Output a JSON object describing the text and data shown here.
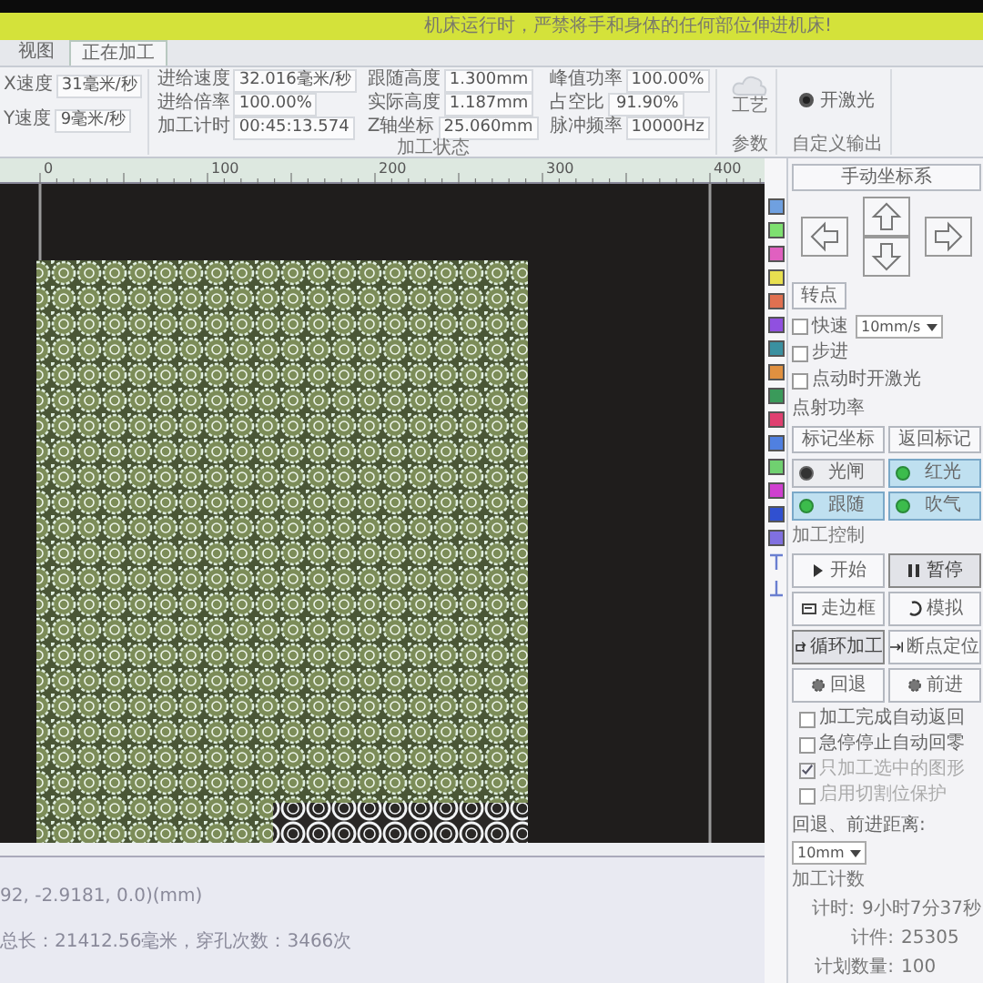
{
  "banner": "机床运行时，严禁将手和身体的任何部位伸进机床!",
  "tabs": [
    {
      "label": "视图",
      "selected": false
    },
    {
      "label": "正在加工",
      "selected": true
    }
  ],
  "ribbon": {
    "speeds": [
      {
        "label": "X速度",
        "value": "31毫米/秒"
      },
      {
        "label": "Y速度",
        "value": "9毫米/秒"
      }
    ],
    "status": {
      "title": "加工状态",
      "columns": [
        [
          {
            "label": "进给速度",
            "value": "32.016毫米/秒"
          },
          {
            "label": "进给倍率",
            "value": "100.00%"
          },
          {
            "label": "加工计时",
            "value": "00:45:13.574"
          }
        ],
        [
          {
            "label": "跟随高度",
            "value": "1.300mm"
          },
          {
            "label": "实际高度",
            "value": "1.187mm"
          },
          {
            "label": "Z轴坐标",
            "value": "25.060mm"
          }
        ],
        [
          {
            "label": "峰值功率",
            "value": "100.00%"
          },
          {
            "label": "占空比",
            "value": "91.90%"
          },
          {
            "label": "脉冲频率",
            "value": "10000Hz"
          }
        ]
      ]
    },
    "process": {
      "button": "工艺",
      "title": "参数"
    },
    "output": {
      "toggle": {
        "label": "开激光",
        "checked": true
      },
      "title": "自定义输出"
    }
  },
  "ruler": [
    "0",
    "100",
    "200",
    "300",
    "400"
  ],
  "log": [
    "92, -2.9181, 0.0)(mm)",
    "总长：21412.56毫米，穿孔次数：3466次"
  ],
  "palette": [
    {
      "color": "#6fa0e0"
    },
    {
      "color": "#7ee070"
    },
    {
      "color": "#e060c0"
    },
    {
      "color": "#e8e050"
    },
    {
      "color": "#e07050"
    },
    {
      "color": "#9050e0"
    },
    {
      "color": "#3a90a0"
    },
    {
      "color": "#e09040"
    },
    {
      "color": "#3a9a5a"
    },
    {
      "color": "#e04070"
    },
    {
      "color": "#5080e0"
    },
    {
      "color": "#70d070"
    },
    {
      "color": "#d040d0"
    },
    {
      "color": "#3050d0"
    },
    {
      "color": "#8070e0"
    }
  ],
  "panel": {
    "title": "手动坐标系",
    "turn_button": "转点",
    "fast": {
      "label": "快速",
      "checked": false
    },
    "speed": "10mm/s",
    "step": {
      "label": "步进",
      "checked": false
    },
    "jog_laser": {
      "label": "点动时开激光",
      "checked": false
    },
    "jog_power_label": "点射功率",
    "mark_buttons": [
      "标记坐标",
      "返回标记"
    ],
    "lamps": [
      {
        "label": "光闸",
        "on": false
      },
      {
        "label": "红光",
        "on": true
      },
      {
        "label": "跟随",
        "on": true
      },
      {
        "label": "吹气",
        "on": true
      }
    ],
    "control": {
      "title": "加工控制",
      "buttons": [
        {
          "label": "开始",
          "pressed": false
        },
        {
          "label": "暂停",
          "pressed": true
        },
        {
          "label": "走边框",
          "pressed": false
        },
        {
          "label": "模拟",
          "pressed": false
        },
        {
          "label": "循环加工",
          "pressed": true
        },
        {
          "label": "断点定位",
          "pressed": false
        },
        {
          "label": "回退",
          "pressed": false
        },
        {
          "label": "前进",
          "pressed": false
        }
      ]
    },
    "options": [
      {
        "label": "加工完成自动返回",
        "checked": false,
        "disabled": false
      },
      {
        "label": "急停停止自动回零",
        "checked": false,
        "disabled": false
      },
      {
        "label": "只加工选中的图形",
        "checked": true,
        "disabled": true
      },
      {
        "label": "启用切割位保护",
        "checked": false,
        "disabled": true
      }
    ],
    "distance": {
      "label": "回退、前进距离:",
      "value": "10mm"
    },
    "counter": {
      "title": "加工计数",
      "rows": [
        {
          "label": "计时:",
          "value": "9小时7分37秒"
        },
        {
          "label": "计件:",
          "value": "25305"
        },
        {
          "label": "计划数量:",
          "value": "100"
        }
      ]
    }
  }
}
